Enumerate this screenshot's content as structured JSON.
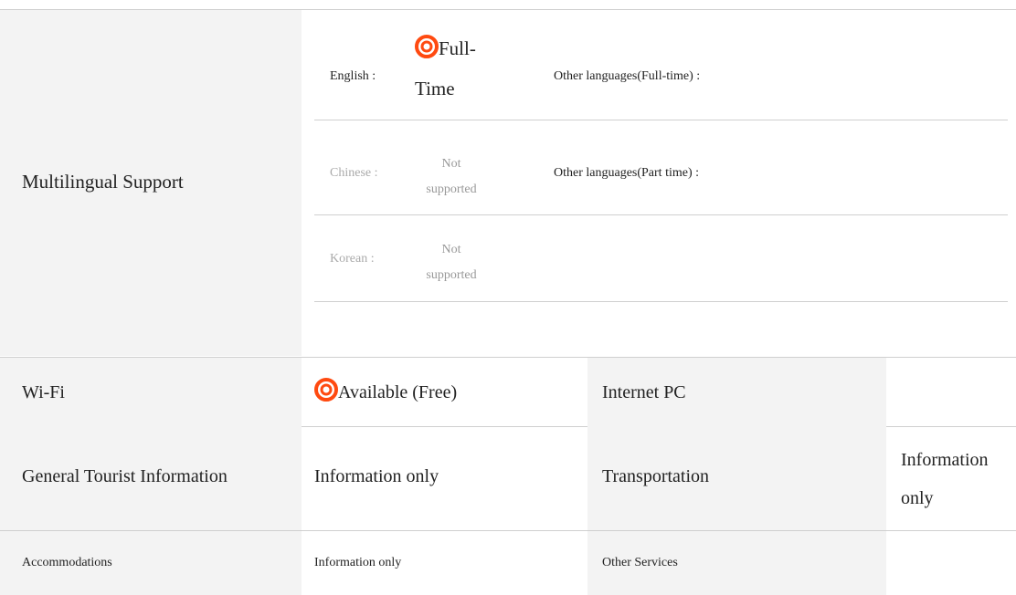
{
  "multilingual": {
    "label": "Multilingual Support",
    "languages": [
      {
        "name": "English :",
        "status_line1": "Full-",
        "status_line2": "Time",
        "available": true,
        "other_label": "Other languages(Full-time) :"
      },
      {
        "name": "Chinese :",
        "status_line1": "Not",
        "status_line2": "supported",
        "available": false,
        "other_label": "Other languages(Part time) :"
      },
      {
        "name": "Korean :",
        "status_line1": "Not",
        "status_line2": "supported",
        "available": false,
        "other_label": ""
      }
    ]
  },
  "rows": {
    "wifi": {
      "label": "Wi-Fi",
      "value": "Available (Free)",
      "label2": "Internet PC",
      "value2": ""
    },
    "tourist": {
      "label": "General Tourist Information",
      "value": "Information only",
      "label2": "Transportation",
      "value2_line1": "Information",
      "value2_line2": "only"
    },
    "accommodations": {
      "label": "Accommodations",
      "value": "Information only",
      "label2": "Other Services",
      "value2": ""
    }
  },
  "icons": {
    "available": "double-ring-icon"
  },
  "colors": {
    "ring": "#ff4a10",
    "label_bg": "#f3f3f3",
    "rule": "#cfcfcf",
    "muted": "#999999"
  }
}
